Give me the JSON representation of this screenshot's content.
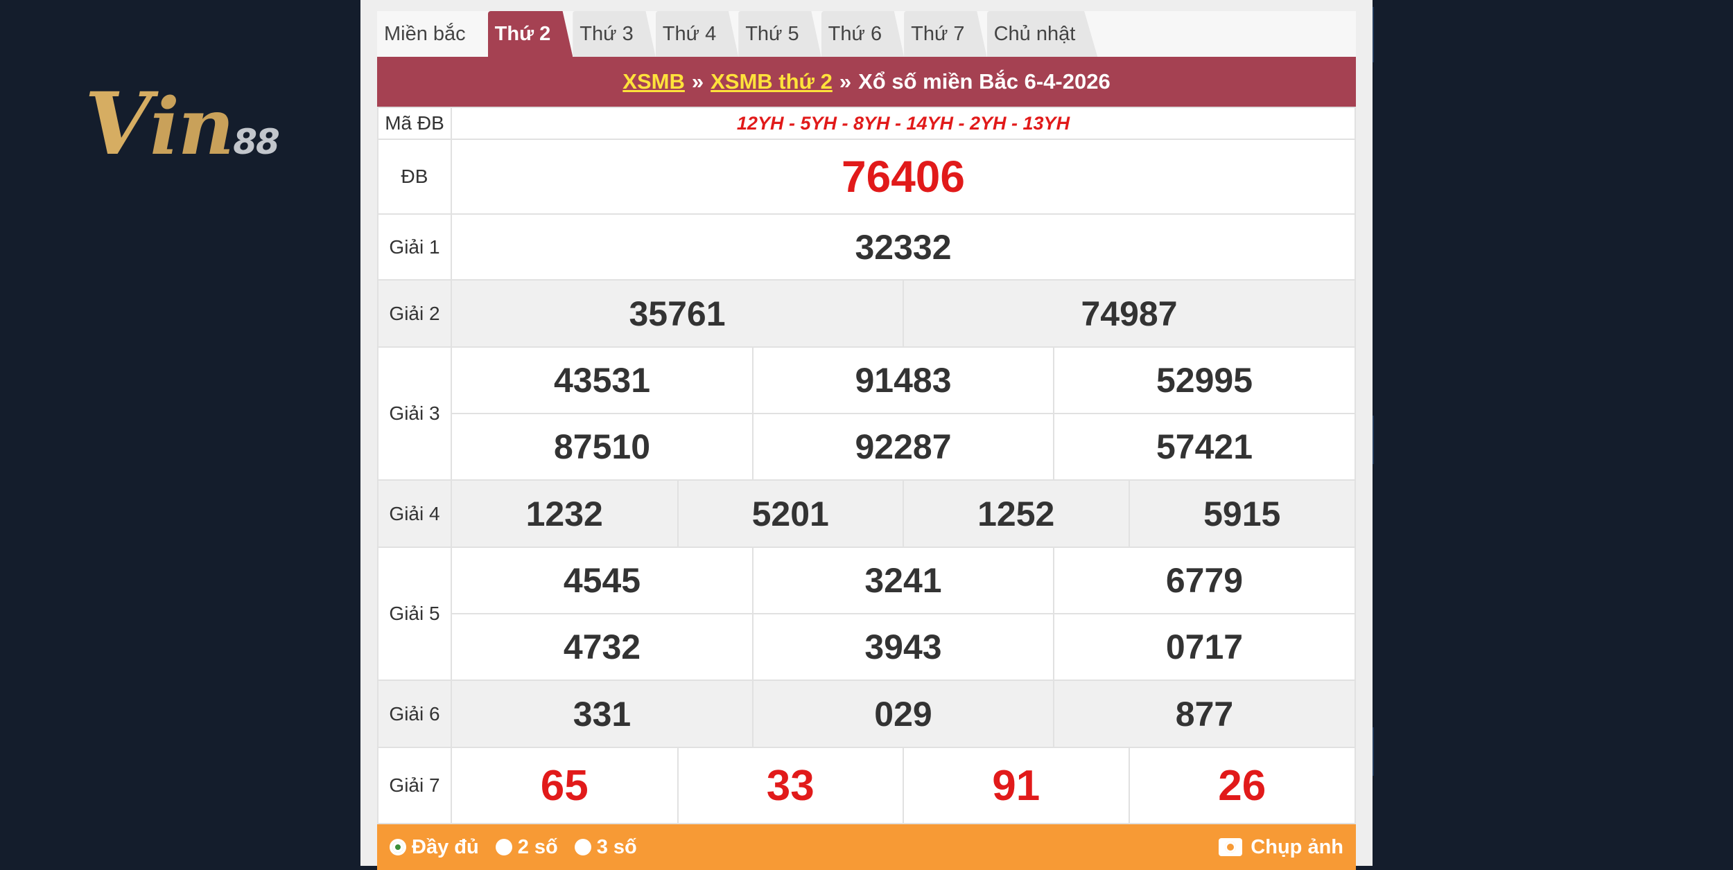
{
  "logo": {
    "text_v": "V",
    "text_in": "in",
    "text_num": "88"
  },
  "tabs": [
    {
      "label": "Miền bắc",
      "active": false
    },
    {
      "label": "Thứ 2",
      "active": true
    },
    {
      "label": "Thứ 3",
      "active": false
    },
    {
      "label": "Thứ 4",
      "active": false
    },
    {
      "label": "Thứ 5",
      "active": false
    },
    {
      "label": "Thứ 6",
      "active": false
    },
    {
      "label": "Thứ 7",
      "active": false
    },
    {
      "label": "Chủ nhật",
      "active": false
    }
  ],
  "title": {
    "link1": "XSMB",
    "sep": "»",
    "link2": "XSMB thứ 2",
    "rest": "Xổ số miền Bắc 6-4-2026"
  },
  "results": {
    "ma_db_label": "Mã ĐB",
    "ma_db": "12YH - 5YH - 8YH - 14YH - 2YH - 13YH",
    "db_label": "ĐB",
    "db": "76406",
    "g1_label": "Giải 1",
    "g1": "32332",
    "g2_label": "Giải 2",
    "g2": [
      "35761",
      "74987"
    ],
    "g3_label": "Giải 3",
    "g3": [
      "43531",
      "91483",
      "52995",
      "87510",
      "92287",
      "57421"
    ],
    "g4_label": "Giải 4",
    "g4": [
      "1232",
      "5201",
      "1252",
      "5915"
    ],
    "g5_label": "Giải 5",
    "g5": [
      "4545",
      "3241",
      "6779",
      "4732",
      "3943",
      "0717"
    ],
    "g6_label": "Giải 6",
    "g6": [
      "331",
      "029",
      "877"
    ],
    "g7_label": "Giải 7",
    "g7": [
      "65",
      "33",
      "91",
      "26"
    ]
  },
  "footer": {
    "options": [
      {
        "label": "Đầy đủ",
        "checked": true
      },
      {
        "label": "2 số",
        "checked": false
      },
      {
        "label": "3 số",
        "checked": false
      }
    ],
    "capture_label": "Chụp ảnh"
  },
  "colors": {
    "background": "#141d2c",
    "header_accent": "#a54152",
    "link_yellow": "#ffe23b",
    "footer_orange": "#f79a35",
    "prize_red": "#e11a1a"
  }
}
